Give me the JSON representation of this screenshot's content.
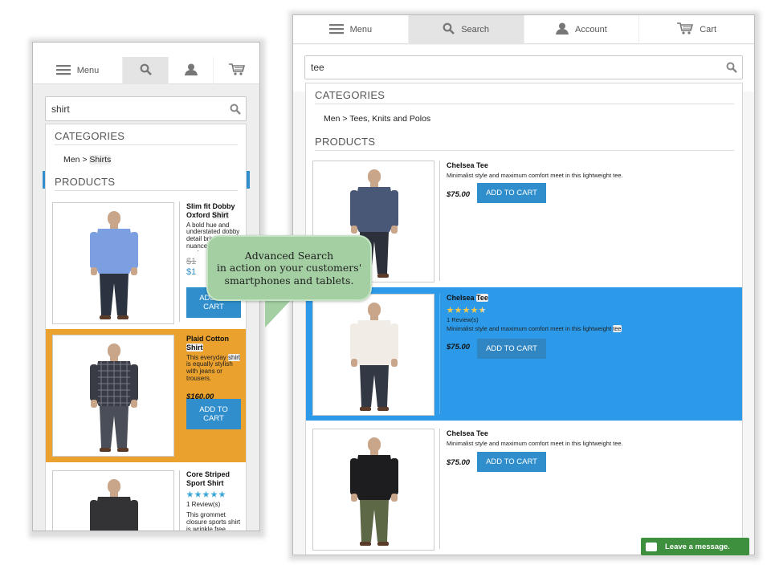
{
  "bubble": {
    "line1": "Advanced Search",
    "line2": "in action on your customers'",
    "line3": "smartphones and tablets."
  },
  "chat": {
    "label": "Leave a message."
  },
  "phone": {
    "nav": {
      "menu": "Menu"
    },
    "search": {
      "value": "shirt"
    },
    "categories_heading": "CATEGORIES",
    "category": {
      "prefix": "Men > ",
      "match": "Shirts"
    },
    "products_heading": "PRODUCTS",
    "products": [
      {
        "name": "Slim fit Dobby",
        "name2": "Oxford",
        "name_match": "Shirt",
        "desc": "A bold hue and understated dobby detail bring refined nuance to this modern...",
        "old_price": "$1",
        "price": "$1",
        "cart1": "ADD TO",
        "cart2": "CART",
        "shirt": "#7b9fe0",
        "pants": "#2b3340"
      },
      {
        "name": "Plaid Cotton",
        "name_match": "Shirt",
        "desc_a": "This everyday ",
        "desc_match": "shirt",
        "desc_b": " is equally stylish with jeans or trousers.",
        "price": "$160.00",
        "cart1": "ADD TO",
        "cart2": "CART",
        "highlight": "#eaa12e",
        "shirt": "#3a3c45",
        "pants": "#4a4e58"
      },
      {
        "name": "Core Striped",
        "name2": "Sport Shirt",
        "reviews": "1 Review(s)",
        "rating": 5,
        "desc": "This grommet closure sports shirt is wrinkle free",
        "shirt": "#333336",
        "pants": "#3a3a3d"
      }
    ]
  },
  "tablet": {
    "nav": {
      "menu": "Menu",
      "search": "Search",
      "account": "Account",
      "cart": "Cart"
    },
    "search": {
      "value": "tee"
    },
    "categories_heading": "CATEGORIES",
    "category": {
      "text": "Men > Tees, Knits and Polos"
    },
    "products_heading": "PRODUCTS",
    "products": [
      {
        "name": "Chelsea Tee",
        "desc": "Minimalist style and maximum comfort meet in this lightweight tee.",
        "price": "$75.00",
        "cart": "ADD TO CART",
        "shirt": "#4a5878",
        "pants": "#2b303b"
      },
      {
        "name_a": "Chelsea ",
        "name_match": "Tee",
        "rating": 4.5,
        "reviews": "1 Review(s)",
        "desc_a": "Minimalist style and maximum comfort meet in this lightweight ",
        "desc_match": "tee",
        "price": "$75.00",
        "cart": "ADD TO CART",
        "highlight": "#2c9ae8",
        "shirt": "#f1ede6",
        "pants": "#333944"
      },
      {
        "name": "Chelsea Tee",
        "desc": "Minimalist style and maximum comfort meet in this lightweight tee.",
        "price": "$75.00",
        "cart": "ADD TO CART",
        "shirt": "#1d1d1f",
        "pants": "#5d6847"
      }
    ]
  },
  "colors": {
    "button": "#2f8ecb",
    "phone_highlight": "#eaa12e",
    "tablet_highlight": "#2c9ae8",
    "bubble": "#a3cfa3",
    "chat": "#3e8f3e"
  }
}
